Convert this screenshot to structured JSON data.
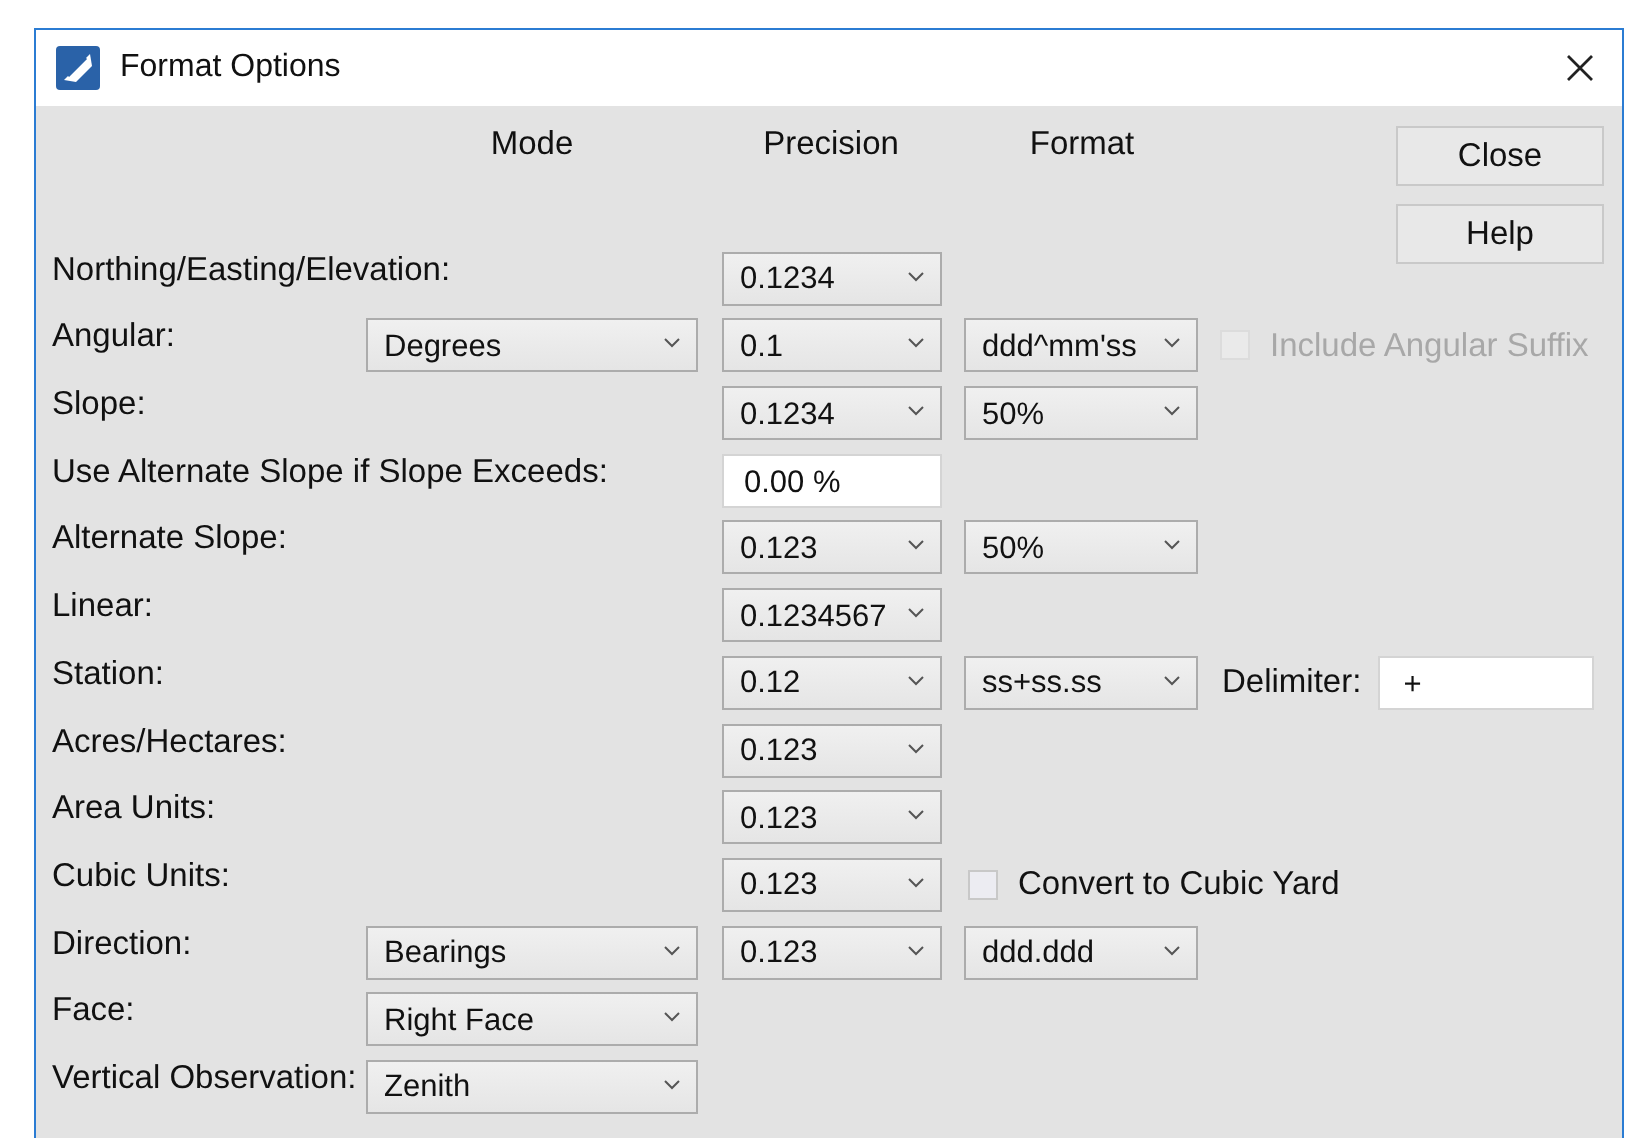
{
  "window": {
    "title": "Format Options"
  },
  "columns": [
    "Mode",
    "Precision",
    "Format"
  ],
  "buttons": [
    "Close",
    "Help"
  ],
  "rows": [
    {
      "label": "Northing/Easting/Elevation:",
      "precision": {
        "kind": "dropdown",
        "value": "0.1234"
      }
    },
    {
      "label": "Angular:",
      "mode": {
        "kind": "dropdown",
        "value": "Degrees"
      },
      "precision": {
        "kind": "dropdown",
        "value": "0.1"
      },
      "format": {
        "kind": "dropdown",
        "value": "ddd^mm'ss"
      },
      "extra": {
        "kind": "checkbox",
        "label": "Include Angular Suffix",
        "checked": false,
        "disabled": true
      }
    },
    {
      "label": "Slope:",
      "precision": {
        "kind": "dropdown",
        "value": "0.1234"
      },
      "format": {
        "kind": "dropdown",
        "value": "50%"
      }
    },
    {
      "label": "Use Alternate Slope if Slope Exceeds:",
      "precision": {
        "kind": "field",
        "value": "0.00 %"
      }
    },
    {
      "label": "Alternate Slope:",
      "precision": {
        "kind": "dropdown",
        "value": "0.123"
      },
      "format": {
        "kind": "dropdown",
        "value": "50%"
      }
    },
    {
      "label": "Linear:",
      "precision": {
        "kind": "dropdown",
        "value": "0.1234567"
      }
    },
    {
      "label": "Station:",
      "precision": {
        "kind": "dropdown",
        "value": "0.12"
      },
      "format": {
        "kind": "dropdown",
        "value": "ss+ss.ss"
      },
      "extra": {
        "kind": "field",
        "label": "Delimiter:",
        "value": "+"
      }
    },
    {
      "label": "Acres/Hectares:",
      "precision": {
        "kind": "dropdown",
        "value": "0.123"
      }
    },
    {
      "label": "Area Units:",
      "precision": {
        "kind": "dropdown",
        "value": "0.123"
      }
    },
    {
      "label": "Cubic Units:",
      "precision": {
        "kind": "dropdown",
        "value": "0.123"
      },
      "format": {
        "kind": "checkbox",
        "label": "Convert to Cubic Yard",
        "checked": false,
        "disabled": false
      }
    },
    {
      "label": "Direction:",
      "mode": {
        "kind": "dropdown",
        "value": "Bearings"
      },
      "precision": {
        "kind": "dropdown",
        "value": "0.123"
      },
      "format": {
        "kind": "dropdown",
        "value": "ddd.ddd"
      }
    },
    {
      "label": "Face:",
      "mode": {
        "kind": "dropdown",
        "value": "Right Face"
      }
    },
    {
      "label": "Vertical Observation:",
      "mode": {
        "kind": "dropdown",
        "value": "Zenith"
      }
    }
  ]
}
